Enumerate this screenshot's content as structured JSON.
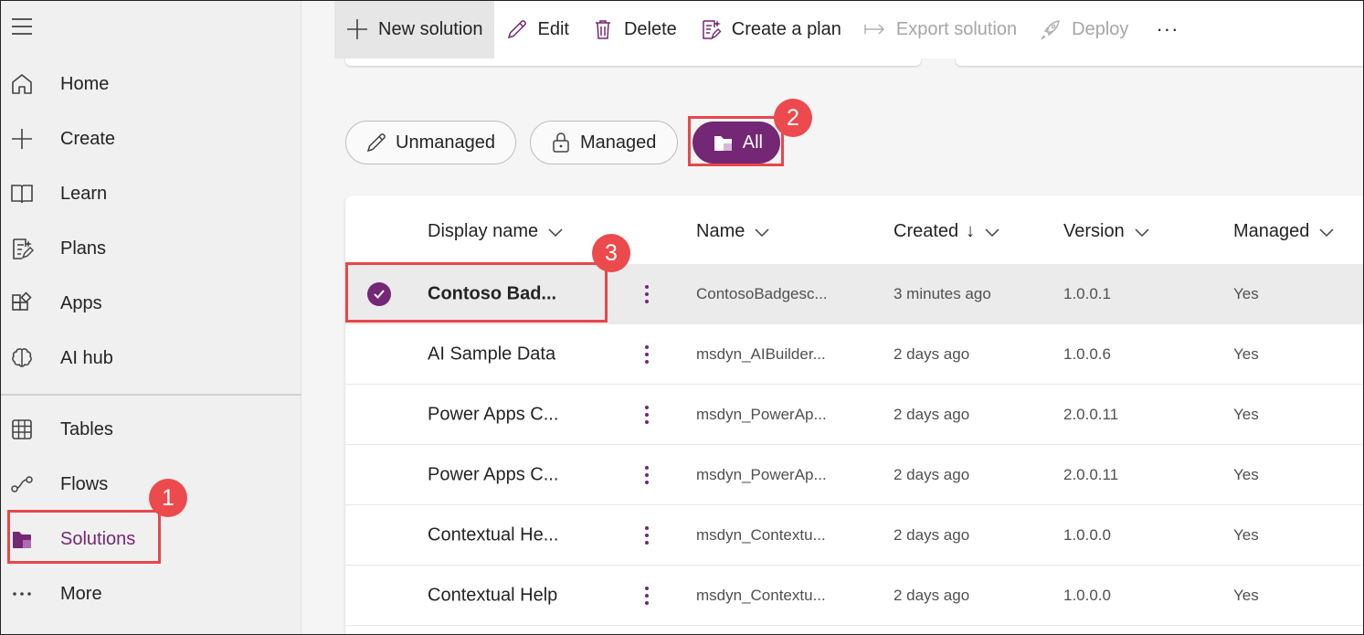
{
  "sidebar": {
    "menu_icon": "hamburger-icon",
    "items": [
      {
        "label": "Home",
        "icon": "home-icon"
      },
      {
        "label": "Create",
        "icon": "plus-icon"
      },
      {
        "label": "Learn",
        "icon": "book-icon"
      },
      {
        "label": "Plans",
        "icon": "plan-icon"
      },
      {
        "label": "Apps",
        "icon": "apps-icon"
      },
      {
        "label": "AI hub",
        "icon": "brain-icon"
      },
      {
        "label": "Tables",
        "icon": "table-icon"
      },
      {
        "label": "Flows",
        "icon": "flow-icon"
      },
      {
        "label": "Solutions",
        "icon": "solutions-icon",
        "active": true
      },
      {
        "label": "More",
        "icon": "more-icon"
      }
    ]
  },
  "toolbar": {
    "new_solution": "New solution",
    "edit": "Edit",
    "delete": "Delete",
    "create_plan": "Create a plan",
    "export_solution": "Export solution",
    "deploy": "Deploy",
    "overflow": "···"
  },
  "filters": {
    "unmanaged": "Unmanaged",
    "managed": "Managed",
    "all": "All",
    "selected": "All"
  },
  "annotations": {
    "step1": "1",
    "step2": "2",
    "step3": "3"
  },
  "table": {
    "columns": {
      "display_name": "Display name",
      "name": "Name",
      "created": "Created",
      "created_sort": "↓",
      "version": "Version",
      "managed": "Managed"
    },
    "rows": [
      {
        "display_name": "Contoso Bad...",
        "name": "ContosoBadgesc...",
        "created": "3 minutes ago",
        "version": "1.0.0.1",
        "managed": "Yes",
        "selected": true
      },
      {
        "display_name": "AI Sample Data",
        "name": "msdyn_AIBuilder...",
        "created": "2 days ago",
        "version": "1.0.0.6",
        "managed": "Yes"
      },
      {
        "display_name": "Power Apps C...",
        "name": "msdyn_PowerAp...",
        "created": "2 days ago",
        "version": "2.0.0.11",
        "managed": "Yes"
      },
      {
        "display_name": "Power Apps C...",
        "name": "msdyn_PowerAp...",
        "created": "2 days ago",
        "version": "2.0.0.11",
        "managed": "Yes"
      },
      {
        "display_name": "Contextual He...",
        "name": "msdyn_Contextu...",
        "created": "2 days ago",
        "version": "1.0.0.0",
        "managed": "Yes"
      },
      {
        "display_name": "Contextual Help",
        "name": "msdyn_Contextu...",
        "created": "2 days ago",
        "version": "1.0.0.0",
        "managed": "Yes"
      }
    ]
  },
  "colors": {
    "accent": "#742774",
    "annotation": "#e8474a"
  }
}
